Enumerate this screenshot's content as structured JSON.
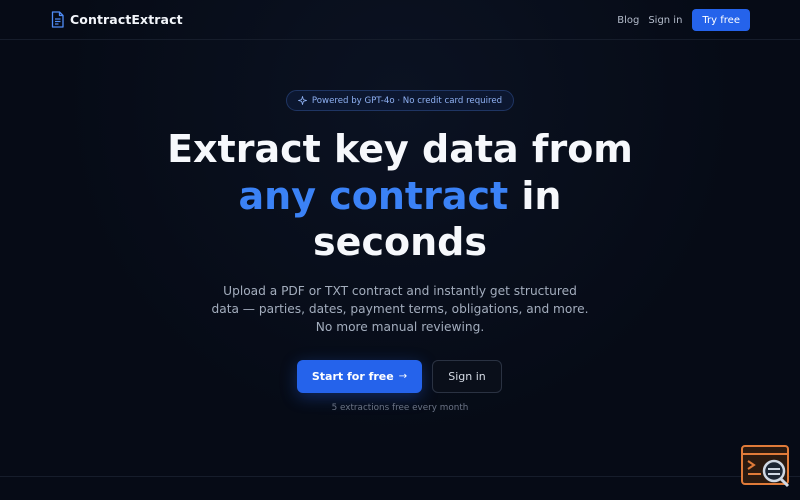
{
  "brand": {
    "name": "ContractExtract",
    "icon": "document-icon"
  },
  "nav": {
    "links": [
      "Blog",
      "Sign in"
    ],
    "cta": "Try free"
  },
  "badge": {
    "icon": "sparkle-icon",
    "text": "Powered by GPT-4o · No credit card required"
  },
  "hero": {
    "title_line1": "Extract key data from",
    "title_accent": "any contract",
    "title_after_accent": " in",
    "title_line3": "seconds",
    "description": "Upload a PDF or TXT contract and instantly get structured data — parties, dates, payment terms, obligations, and more. No more manual reviewing.",
    "primary_cta": "Start for free",
    "primary_cta_icon": "arrow-right-icon",
    "secondary_cta": "Sign in",
    "note": "5 extractions free every month"
  },
  "widget": {
    "icon": "terminal-search-icon"
  },
  "colors": {
    "background": "#060b16",
    "accent": "#2563eb",
    "accent_text": "#3b82f6"
  }
}
